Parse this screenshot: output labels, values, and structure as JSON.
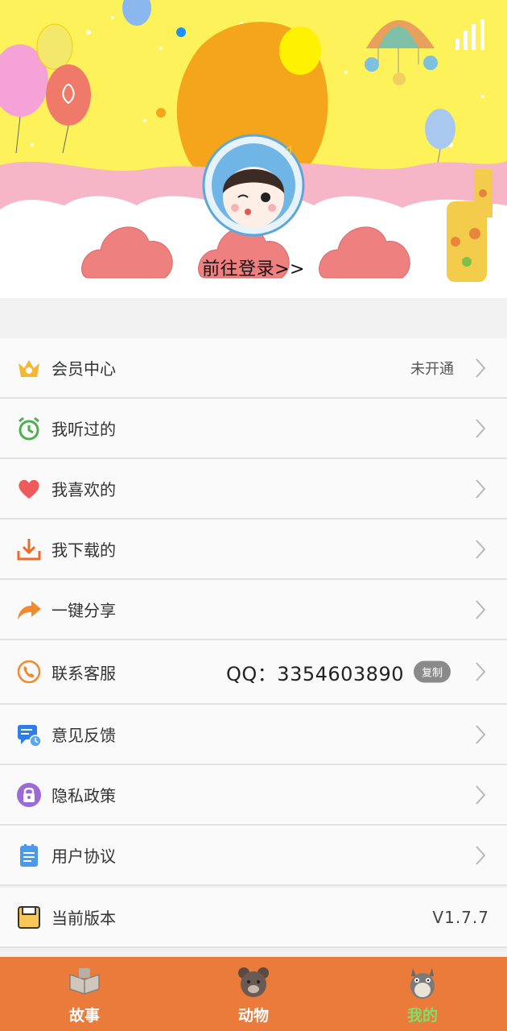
{
  "header": {
    "login_prompt": "前往登录>>",
    "avatar_icon": "child-avatar-icon",
    "signal_icon": "signal-bars-icon"
  },
  "menu": {
    "items": [
      {
        "label": "会员中心",
        "icon": "crown-icon",
        "right": "未开通"
      },
      {
        "label": "我听过的",
        "icon": "alarm-clock-icon"
      },
      {
        "label": "我喜欢的",
        "icon": "heart-icon"
      },
      {
        "label": "我下载的",
        "icon": "download-icon"
      },
      {
        "label": "一键分享",
        "icon": "share-arrow-icon"
      },
      {
        "label": "联系客服",
        "icon": "phone-icon",
        "qq": "QQ：3354603890",
        "copy": "复制"
      },
      {
        "label": "意见反馈",
        "icon": "feedback-icon"
      },
      {
        "label": "隐私政策",
        "icon": "lock-icon"
      },
      {
        "label": "用户协议",
        "icon": "document-icon"
      },
      {
        "label": "当前版本",
        "icon": "save-disk-icon",
        "version": "V1.7.7"
      }
    ]
  },
  "tabbar": {
    "tabs": [
      {
        "label": "故事",
        "icon": "book-icon",
        "active": false
      },
      {
        "label": "动物",
        "icon": "bear-icon",
        "active": false
      },
      {
        "label": "我的",
        "icon": "totoro-icon",
        "active": true
      }
    ]
  },
  "colors": {
    "tab_bg": "#ea7b3a",
    "tab_active": "#7ee06b",
    "banner_yellow": "#fdf25a",
    "banner_pink": "#f7b6c8",
    "cloud_red": "#ee8080"
  }
}
